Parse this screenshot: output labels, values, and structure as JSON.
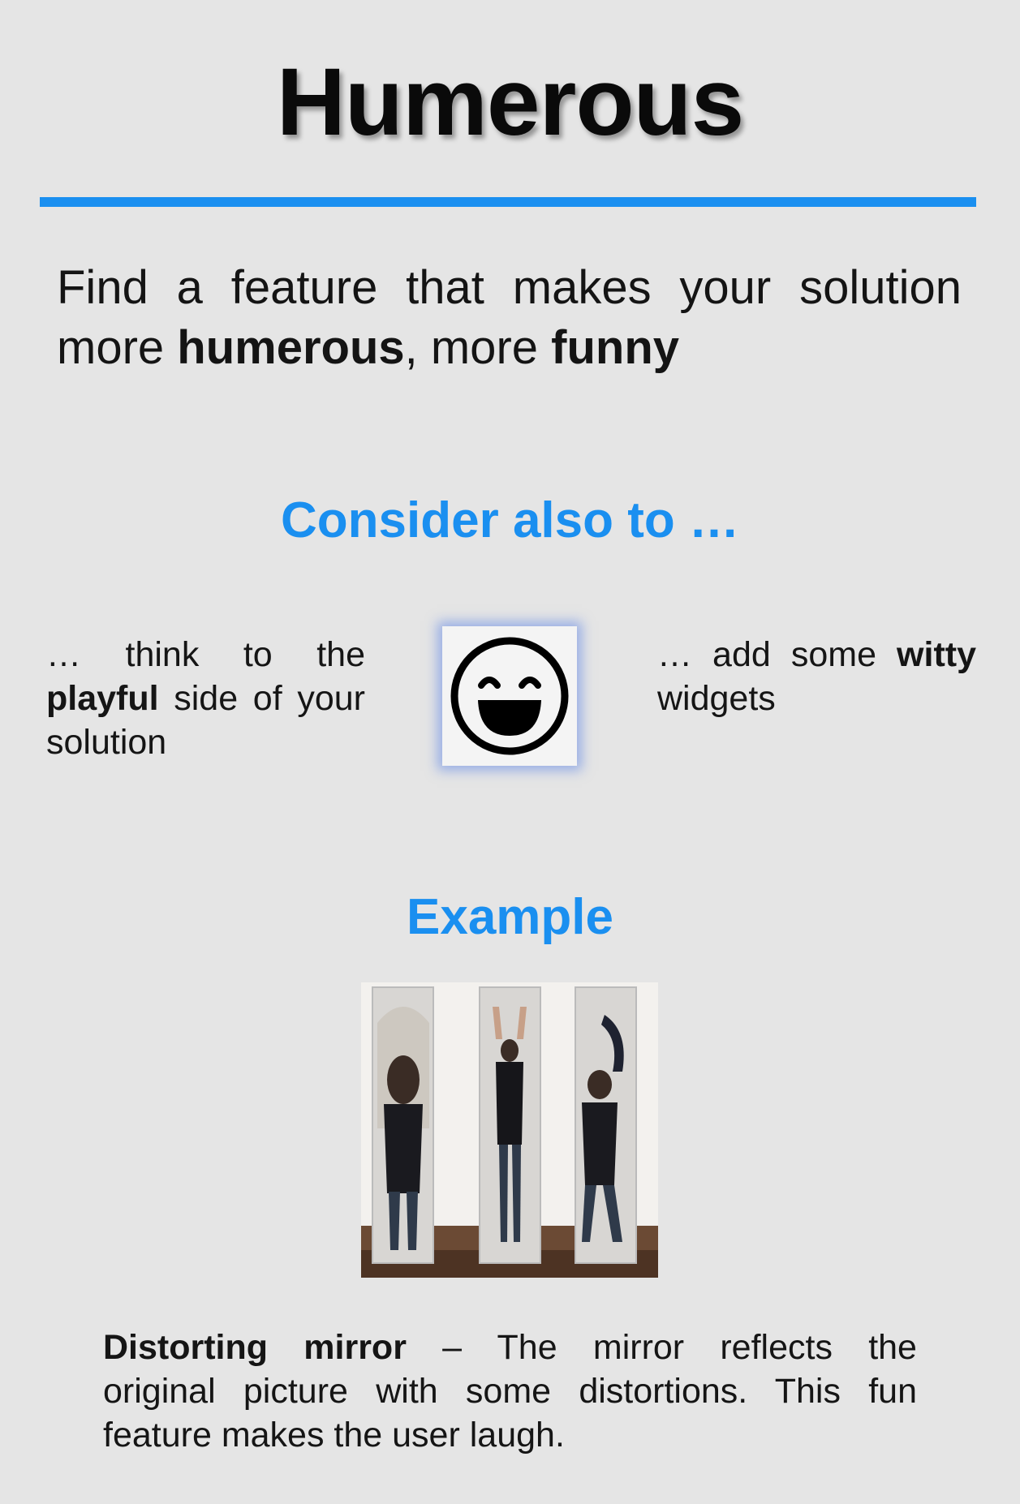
{
  "title": "Humerous",
  "intro": {
    "line1": "Find a feature that makes your solution",
    "line2_prefix": "more ",
    "line2_bold1": "humerous",
    "line2_mid": ", more ",
    "line2_bold2": "funny"
  },
  "consider": {
    "heading": "Consider also to …",
    "left": {
      "line1": "… think to the",
      "line2_bold": "playful",
      "line2_rest": " side of your",
      "line3": "solution"
    },
    "center_icon": "laughing-face-icon",
    "right": {
      "line1_prefix": "… add some ",
      "line1_bold": "witty",
      "line2": "widgets"
    }
  },
  "example": {
    "heading": "Example",
    "image": "distorting-mirror-photo",
    "caption": {
      "bold": "Distorting mirror",
      "line1_rest": " –  The mirror reflects the",
      "line2": "original picture with some distortions. This fun",
      "line3": "feature makes the user laugh."
    }
  },
  "colors": {
    "accent": "#1a8ff0",
    "background": "#e5e5e5",
    "text": "#141414"
  }
}
